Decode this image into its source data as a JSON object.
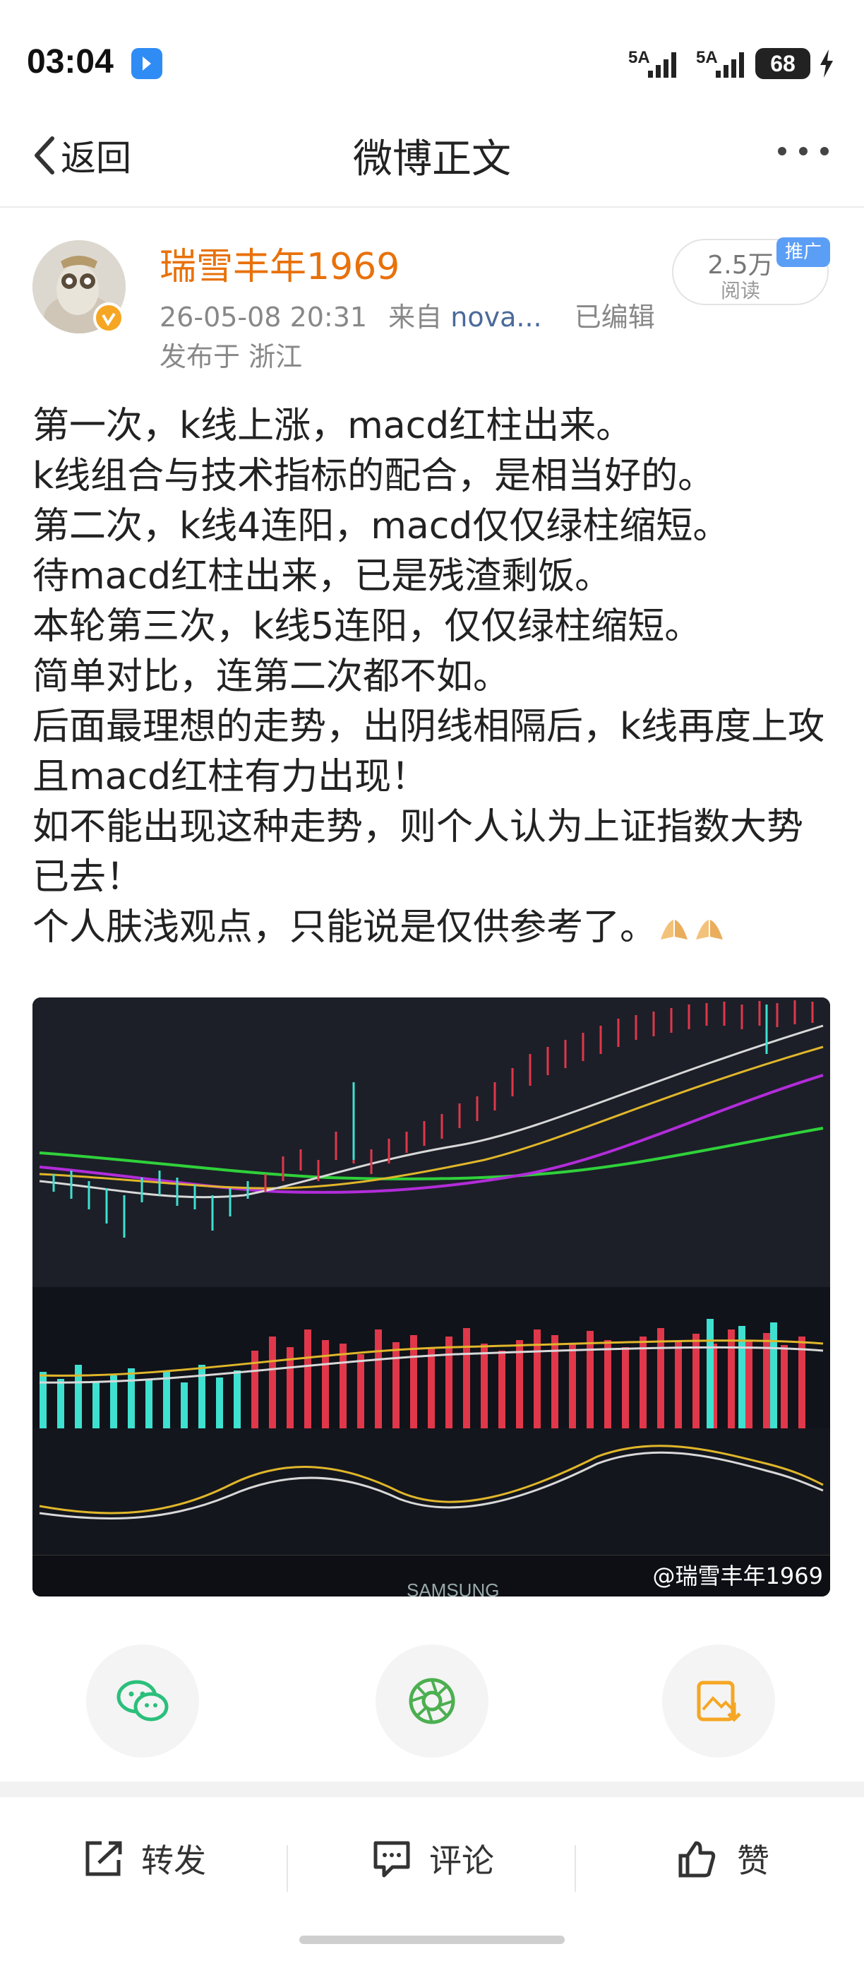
{
  "status_bar": {
    "time": "03:04",
    "network1": "5A",
    "network2": "5A",
    "battery": "68"
  },
  "nav": {
    "back_label": "返回",
    "title": "微博正文"
  },
  "author": {
    "name": "瑞雪丰年1969",
    "timestamp": "26-05-08 20:31",
    "source_prefix": "来自",
    "source": "nova...",
    "edited": "已编辑",
    "location": "发布于 浙江",
    "reads_count": "2.5万",
    "reads_label": "阅读",
    "promo_badge": "推广"
  },
  "post": {
    "lines": [
      "第一次，k线上涨，macd红柱出来。",
      "k线组合与技术指标的配合，是相当好的。",
      "第二次，k线4连阳，macd仅仅绿柱缩短。",
      "待macd红柱出来，已是残渣剩饭。",
      "本轮第三次，k线5连阳，仅仅绿柱缩短。",
      "简单对比，连第二次都不如。",
      "后面最理想的走势，出阴线相隔后，k线再度上攻且macd红柱有力出现！",
      "如不能出现这种走势，则个人认为上证指数大势已去！",
      "个人肤浅观点，只能说是仅供参考了。"
    ]
  },
  "image": {
    "watermark": "@瑞雪丰年1969",
    "monitor_brand": "SAMSUNG"
  },
  "actions": {
    "repost": "转发",
    "comment": "评论",
    "like": "赞"
  }
}
